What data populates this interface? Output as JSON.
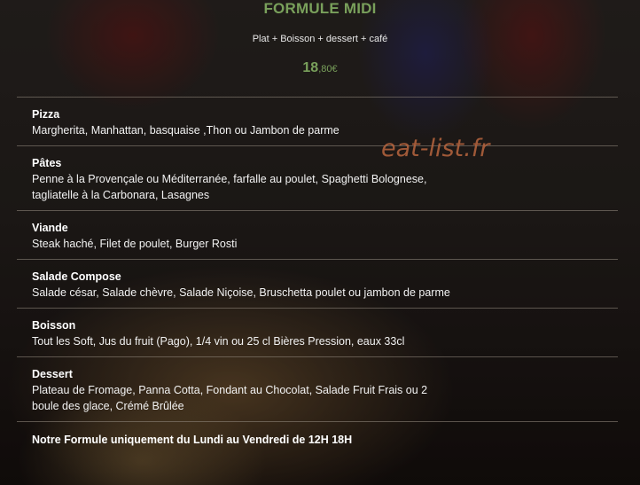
{
  "header": {
    "title": "FORMULE MIDI",
    "subtitle": "Plat + Boisson + dessert + café",
    "price_main": "18",
    "price_cents": ",80€"
  },
  "watermark": "eat-list.fr",
  "sections": [
    {
      "name": "Pizza",
      "desc": "Margherita, Manhattan, basquaise ,Thon ou Jambon de parme"
    },
    {
      "name": "Pâtes",
      "desc": "Penne à la Provençale ou Méditerranée, farfalle au poulet, Spaghetti Bolognese, tagliatelle à la Carbonara, Lasagnes"
    },
    {
      "name": "Viande",
      "desc": "Steak haché, Filet de poulet, Burger Rosti"
    },
    {
      "name": "Salade Compose",
      "desc": "Salade césar, Salade chèvre, Salade Niçoise, Bruschetta poulet ou jambon de parme"
    },
    {
      "name": "Boisson",
      "desc": "Tout les Soft, Jus du fruit (Pago), 1/4 vin ou 25 cl Bières Pression, eaux 33cl"
    },
    {
      "name": "Dessert",
      "desc": "Plateau de Fromage, Panna Cotta, Fondant au Chocolat, Salade Fruit Frais ou 2 boule des glace, Crémé Brûlée"
    }
  ],
  "footer": "Notre Formule uniquement du Lundi au Vendredi de 12H 18H"
}
